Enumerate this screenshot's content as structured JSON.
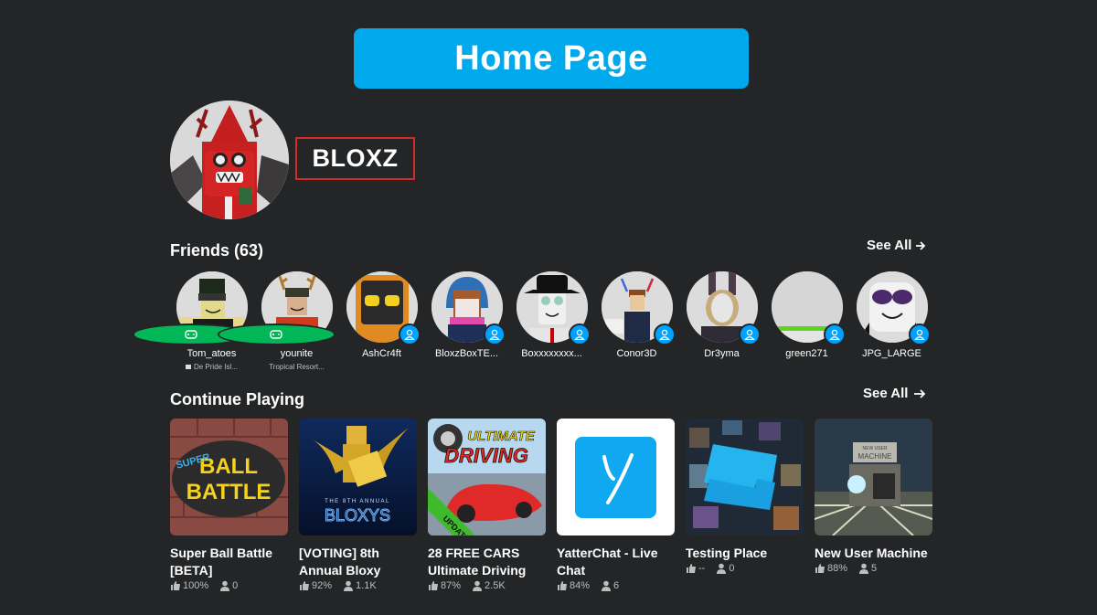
{
  "banner": {
    "title": "Home Page"
  },
  "profile": {
    "username": "BLOXZ"
  },
  "friends": {
    "title": "Friends (63)",
    "see_all_label": "See All",
    "items": [
      {
        "name": "Tom_atoes",
        "status": "in-game",
        "location": "De Pride Isl..."
      },
      {
        "name": "younite",
        "status": "in-game",
        "location": "Tropical Resort..."
      },
      {
        "name": "AshCr4ft",
        "status": "online",
        "location": ""
      },
      {
        "name": "BloxzBoxTE...",
        "status": "online",
        "location": ""
      },
      {
        "name": "Boxxxxxxxx...",
        "status": "online",
        "location": ""
      },
      {
        "name": "Conor3D",
        "status": "online",
        "location": ""
      },
      {
        "name": "Dr3yma",
        "status": "online",
        "location": ""
      },
      {
        "name": "green271",
        "status": "online",
        "location": ""
      },
      {
        "name": "JPG_LARGE",
        "status": "online",
        "location": ""
      }
    ]
  },
  "continue_playing": {
    "title": "Continue Playing",
    "see_all_label": "See All",
    "games": [
      {
        "title": "Super Ball Battle [BETA]",
        "rating": "100%",
        "players": "0",
        "thumb_text": "SUPER BALL BATTLE"
      },
      {
        "title": "[VOTING] 8th Annual Bloxy",
        "rating": "92%",
        "players": "1.1K",
        "thumb_text": "THE 8TH ANNUAL BLOXYS"
      },
      {
        "title": "28 FREE CARS Ultimate Driving",
        "rating": "87%",
        "players": "2.5K",
        "thumb_text": "ULTIMATE DRIVING",
        "thumb_badge": "UPDATE"
      },
      {
        "title": "YatterChat - Live Chat",
        "rating": "84%",
        "players": "6",
        "thumb_text": "y"
      },
      {
        "title": "Testing Place",
        "rating": "--",
        "players": "0",
        "thumb_text": ""
      },
      {
        "title": "New User Machine",
        "rating": "88%",
        "players": "5",
        "thumb_text": "NEW USER MACHINE"
      }
    ]
  },
  "colors": {
    "background": "#232527",
    "banner": "#00a8ec",
    "username_outline": "#d42a2a",
    "status_in_game": "#02b757",
    "status_online": "#00a2ff"
  }
}
